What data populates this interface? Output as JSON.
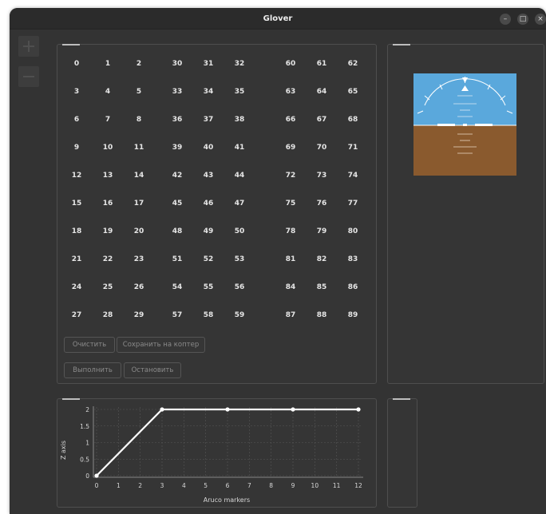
{
  "window": {
    "title": "Glover"
  },
  "titlebar": {
    "minimize_glyph": "–",
    "maximize_glyph": "□",
    "close_glyph": "×"
  },
  "grid": {
    "columns": [
      [
        [
          0,
          1,
          2
        ],
        [
          3,
          4,
          5
        ],
        [
          6,
          7,
          8
        ],
        [
          9,
          10,
          11
        ],
        [
          12,
          13,
          14
        ],
        [
          15,
          16,
          17
        ],
        [
          18,
          19,
          20
        ],
        [
          21,
          22,
          23
        ],
        [
          24,
          25,
          26
        ],
        [
          27,
          28,
          29
        ]
      ],
      [
        [
          30,
          31,
          32
        ],
        [
          33,
          34,
          35
        ],
        [
          36,
          37,
          38
        ],
        [
          39,
          40,
          41
        ],
        [
          42,
          43,
          44
        ],
        [
          45,
          46,
          47
        ],
        [
          48,
          49,
          50
        ],
        [
          51,
          52,
          53
        ],
        [
          54,
          55,
          56
        ],
        [
          57,
          58,
          59
        ]
      ],
      [
        [
          60,
          61,
          62
        ],
        [
          63,
          64,
          65
        ],
        [
          66,
          67,
          68
        ],
        [
          69,
          70,
          71
        ],
        [
          72,
          73,
          74
        ],
        [
          75,
          76,
          77
        ],
        [
          78,
          79,
          80
        ],
        [
          81,
          82,
          83
        ],
        [
          84,
          85,
          86
        ],
        [
          87,
          88,
          89
        ]
      ]
    ]
  },
  "buttons": {
    "clear": "Очистить",
    "save": "Сохранить на коптер",
    "run": "Выполнить",
    "stop": "Остановить"
  },
  "attitude": {
    "sky_color": "#5aa8dc",
    "ground_color": "#8a5a2e"
  },
  "chart_data": {
    "type": "line",
    "x": [
      0,
      3,
      6,
      9,
      12
    ],
    "y": [
      0,
      2,
      2,
      2,
      2
    ],
    "xlabel": "Aruco markers",
    "ylabel": "Z axis",
    "xlim": [
      0,
      12
    ],
    "ylim": [
      0,
      2
    ],
    "xticks": [
      0,
      1,
      2,
      3,
      4,
      5,
      6,
      7,
      8,
      9,
      10,
      11,
      12
    ],
    "yticks": [
      0,
      0.5,
      1,
      1.5,
      2
    ],
    "grid": true,
    "line_color": "#ffffff"
  }
}
